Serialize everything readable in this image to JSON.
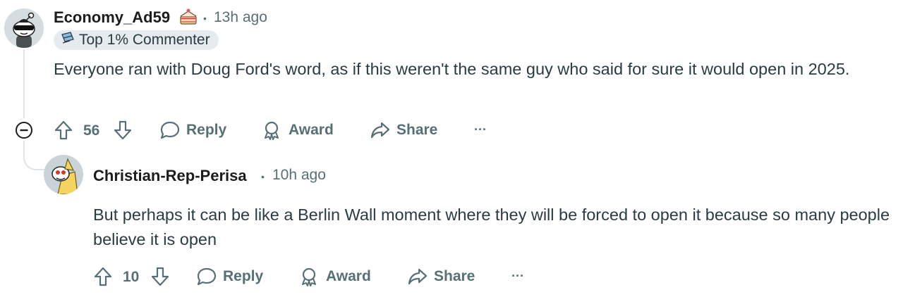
{
  "comments": [
    {
      "author": "Economy_Ad59",
      "cake_icon": "cake-icon",
      "separator": "•",
      "time": "13h ago",
      "flair": "Top 1% Commenter",
      "flair_icon": "commenter-badge-icon",
      "body": "Everyone ran with Doug Ford's word, as if this weren't the same guy who said for sure it would open in 2025.",
      "votes": "56",
      "actions": {
        "reply": "Reply",
        "award": "Award",
        "share": "Share",
        "more": "···"
      }
    },
    {
      "author": "Christian-Rep-Perisa",
      "separator": "•",
      "time": "10h ago",
      "body": "But perhaps it can be like a Berlin Wall moment where they will be forced to open it because so many people believe it is open",
      "votes": "10",
      "actions": {
        "reply": "Reply",
        "award": "Award",
        "share": "Share",
        "more": "···"
      }
    }
  ],
  "colors": {
    "text": "#2a3c42",
    "muted": "#576f76",
    "flair_bg": "#e5ebee",
    "thread_line": "#dfe4e7"
  }
}
